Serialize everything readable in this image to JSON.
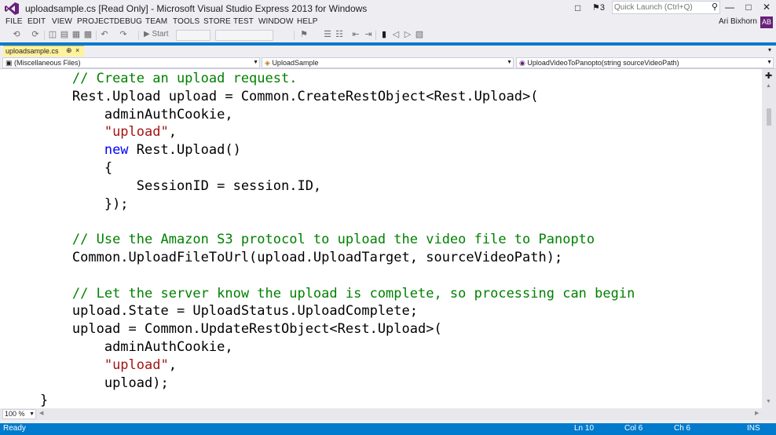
{
  "window": {
    "title": "uploadsample.cs [Read Only] - Microsoft Visual Studio Express 2013 for Windows",
    "notification_count": "3",
    "quick_launch_placeholder": "Quick Launch (Ctrl+Q)",
    "user_name": "Ari Bixhorn",
    "avatar_initials": "AB",
    "minimize_glyph": "—",
    "maximize_glyph": "□",
    "close_glyph": "✕"
  },
  "menu": [
    "FILE",
    "EDIT",
    "VIEW",
    "PROJECT",
    "DEBUG",
    "TEAM",
    "TOOLS",
    "STORE",
    "TEST",
    "WINDOW",
    "HELP"
  ],
  "toolbar": {
    "start_label": "Start"
  },
  "tabs": {
    "active_label": "uploadsample.cs",
    "pin_glyph": "⊕",
    "close_glyph": "×"
  },
  "navigation": {
    "project": "(Miscellaneous Files)",
    "type": "UploadSample",
    "member": "UploadVideoToPanopto(string sourceVideoPath)"
  },
  "code_lines": [
    {
      "indent": "        ",
      "segments": [
        {
          "t": "// Create an upload request.",
          "k": "comment"
        }
      ]
    },
    {
      "indent": "        ",
      "segments": [
        {
          "t": "Rest.Upload upload = Common.CreateRestObject<Rest.Upload>(",
          "k": "plain"
        }
      ]
    },
    {
      "indent": "            ",
      "segments": [
        {
          "t": "adminAuthCookie,",
          "k": "plain"
        }
      ]
    },
    {
      "indent": "            ",
      "segments": [
        {
          "t": "\"upload\"",
          "k": "string"
        },
        {
          "t": ",",
          "k": "plain"
        }
      ]
    },
    {
      "indent": "            ",
      "segments": [
        {
          "t": "new",
          "k": "keyword"
        },
        {
          "t": " Rest.Upload()",
          "k": "plain"
        }
      ]
    },
    {
      "indent": "            ",
      "segments": [
        {
          "t": "{",
          "k": "plain"
        }
      ]
    },
    {
      "indent": "                ",
      "segments": [
        {
          "t": "SessionID = session.ID,",
          "k": "plain"
        }
      ]
    },
    {
      "indent": "            ",
      "segments": [
        {
          "t": "});",
          "k": "plain"
        }
      ]
    },
    {
      "indent": "",
      "segments": []
    },
    {
      "indent": "        ",
      "segments": [
        {
          "t": "// Use the Amazon S3 protocol to upload the video file to Panopto",
          "k": "comment"
        }
      ]
    },
    {
      "indent": "        ",
      "segments": [
        {
          "t": "Common.UploadFileToUrl(upload.UploadTarget, sourceVideoPath);",
          "k": "plain"
        }
      ]
    },
    {
      "indent": "",
      "segments": []
    },
    {
      "indent": "        ",
      "segments": [
        {
          "t": "// Let the server know the upload is complete, so processing can begin",
          "k": "comment"
        }
      ]
    },
    {
      "indent": "        ",
      "segments": [
        {
          "t": "upload.State = UploadStatus.UploadComplete;",
          "k": "plain"
        }
      ]
    },
    {
      "indent": "        ",
      "segments": [
        {
          "t": "upload = Common.UpdateRestObject<Rest.Upload>(",
          "k": "plain"
        }
      ]
    },
    {
      "indent": "            ",
      "segments": [
        {
          "t": "adminAuthCookie,",
          "k": "plain"
        }
      ]
    },
    {
      "indent": "            ",
      "segments": [
        {
          "t": "\"upload\"",
          "k": "string"
        },
        {
          "t": ",",
          "k": "plain"
        }
      ]
    },
    {
      "indent": "            ",
      "segments": [
        {
          "t": "upload);",
          "k": "plain"
        }
      ]
    },
    {
      "indent": "    ",
      "segments": [
        {
          "t": "}",
          "k": "plain"
        }
      ]
    }
  ],
  "editor": {
    "zoom": "100 %"
  },
  "status": {
    "state": "Ready",
    "line": "Ln 10",
    "col": "Col 6",
    "ch": "Ch 6",
    "mode": "INS"
  },
  "colors": {
    "accent": "#007ACC",
    "comment": "#008000",
    "keyword": "#0000FF",
    "string": "#A31515",
    "active_tab": "#FFF29D",
    "vs_purple": "#68217A"
  }
}
